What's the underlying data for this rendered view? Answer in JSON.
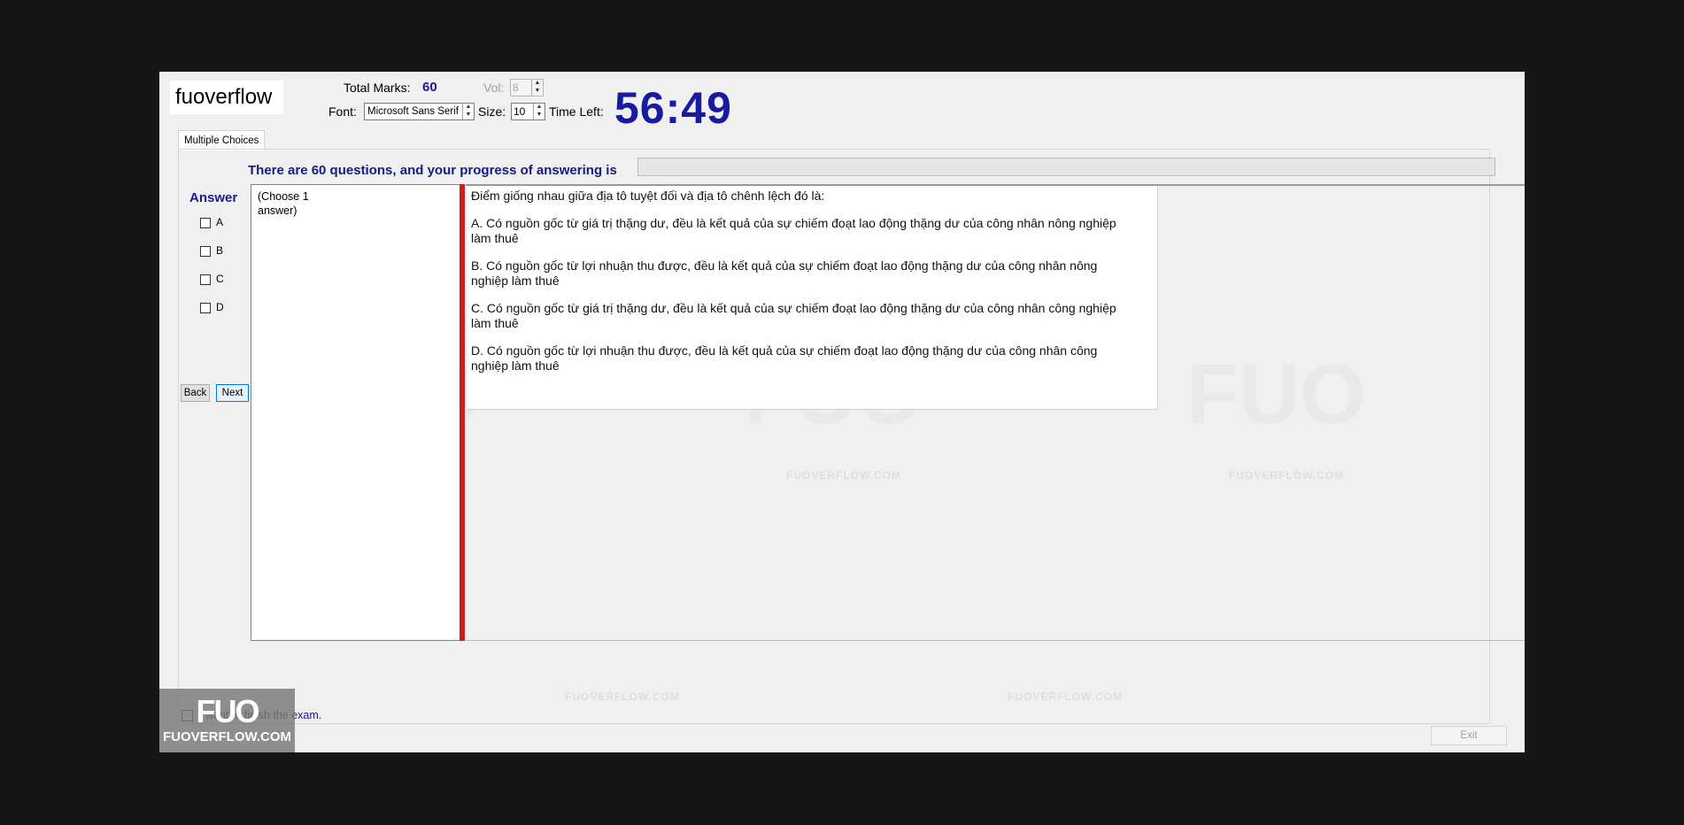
{
  "header": {
    "brand": "fuoverflow",
    "total_marks_label": "Total Marks:",
    "total_marks_value": "60",
    "vol_label": "Vol:",
    "vol_value": "8",
    "font_label": "Font:",
    "font_value": "Microsoft Sans Serif",
    "size_label": "Size:",
    "size_value": "10",
    "time_left_label": "Time Left:",
    "timer": "56:49"
  },
  "tabs": [
    "Multiple Choices"
  ],
  "progress": {
    "text": "There are 60 questions, and your progress of answering is",
    "value": 0
  },
  "answer": {
    "title": "Answer",
    "options": [
      "A",
      "B",
      "C",
      "D"
    ],
    "back_label": "Back",
    "next_label": "Next",
    "choose_hint": "(Choose 1 answer)"
  },
  "question": {
    "stem": "Điểm giống nhau giữa địa tô tuyệt đối và địa tô chênh lệch đó là:",
    "options": [
      "A.  Có nguồn gốc từ giá trị thặng dư, đều là kết quả của sự chiếm đoạt lao động thặng dư của công nhân nông nghiệp làm thuê",
      "B.  Có nguồn gốc từ lợi nhuận thu được, đều là kết quả của sự chiếm đoạt lao động thặng dư của công nhân nông nghiệp làm thuê",
      "C.  Có nguồn gốc từ giá trị thặng dư, đều là kết quả của sự chiếm đoạt lao động thặng dư của công nhân công nghiệp làm thuê",
      "D.  Có nguồn gốc từ lợi nhuận thu được, đều là kết quả của sự chiếm đoạt lao động thặng dư của công nhân công nghiệp làm thuê"
    ]
  },
  "footer": {
    "finish_label": "I want to finish the exam.",
    "exit_label": "Exit"
  },
  "watermark": {
    "big": "FUO",
    "small": "FUOVERFLOW.COM"
  },
  "logo": {
    "line1": "FUO",
    "line2": "FUOVERFLOW.COM"
  }
}
